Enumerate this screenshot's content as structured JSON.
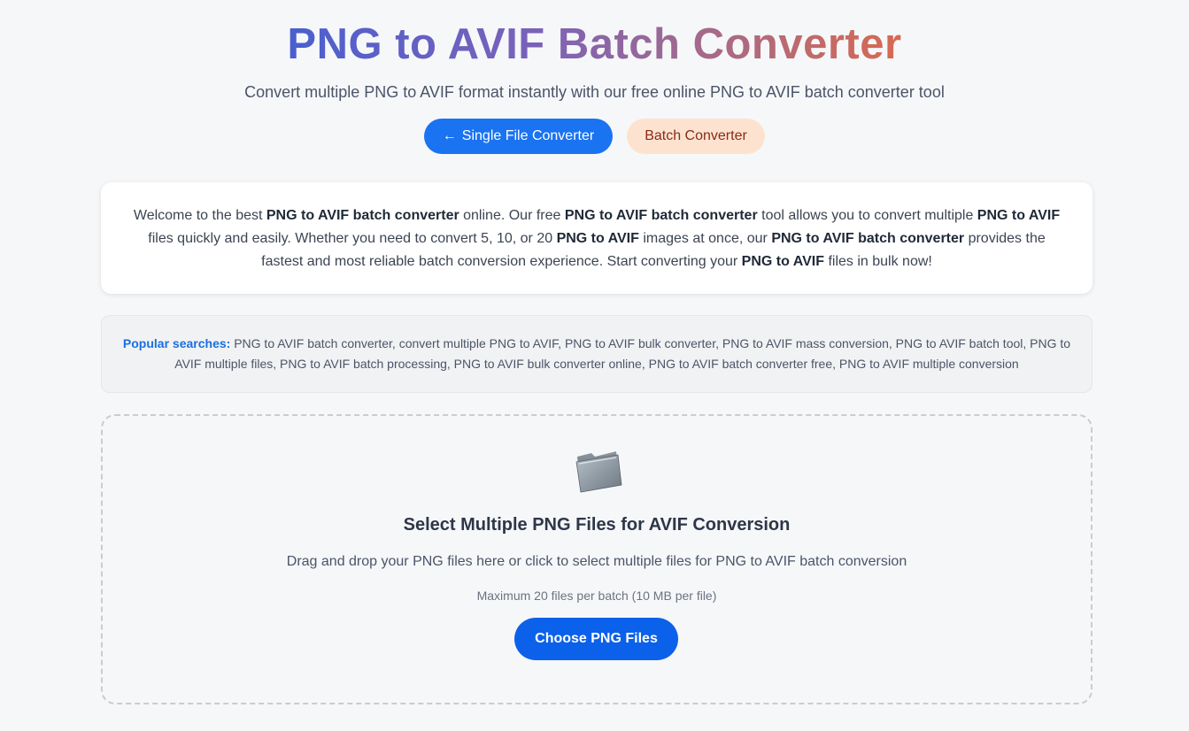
{
  "header": {
    "title": "PNG to AVIF Batch Converter",
    "subtitle": "Convert multiple PNG to AVIF format instantly with our free online PNG to AVIF batch converter tool"
  },
  "nav": {
    "single_arrow": "←",
    "single_label": "Single File Converter",
    "batch_label": "Batch Converter"
  },
  "intro": {
    "p1": "Welcome to the best ",
    "b1": "PNG to AVIF batch converter",
    "p2": " online. Our free ",
    "b2": "PNG to AVIF batch converter",
    "p3": " tool allows you to convert multiple ",
    "b3": "PNG to AVIF",
    "p4": " files quickly and easily. Whether you need to convert 5, 10, or 20 ",
    "b4": "PNG to AVIF",
    "p5": " images at once, our ",
    "b5": "PNG to AVIF batch converter",
    "p6": " provides the fastest and most reliable batch conversion experience. Start converting your ",
    "b6": "PNG to AVIF",
    "p7": " files in bulk now!"
  },
  "popular": {
    "label": "Popular searches:",
    "text": " PNG to AVIF batch converter, convert multiple PNG to AVIF, PNG to AVIF bulk converter, PNG to AVIF mass conversion, PNG to AVIF batch tool, PNG to AVIF multiple files, PNG to AVIF batch processing, PNG to AVIF bulk converter online, PNG to AVIF batch converter free, PNG to AVIF multiple conversion"
  },
  "dropzone": {
    "icon": "folder-icon",
    "title": "Select Multiple PNG Files for AVIF Conversion",
    "description": "Drag and drop your PNG files here or click to select multiple files for PNG to AVIF batch conversion",
    "limit": "Maximum 20 files per batch (10 MB per file)",
    "button_label": "Choose PNG Files"
  },
  "colors": {
    "primary_button": "#1a73f0",
    "choose_button": "#0b61ea",
    "batch_pill_bg": "#fde3cf",
    "batch_pill_text": "#8a2a17",
    "popular_label": "#1a6fe0",
    "title_gradient_start": "#4a5fd0",
    "title_gradient_end": "#d76a50"
  }
}
